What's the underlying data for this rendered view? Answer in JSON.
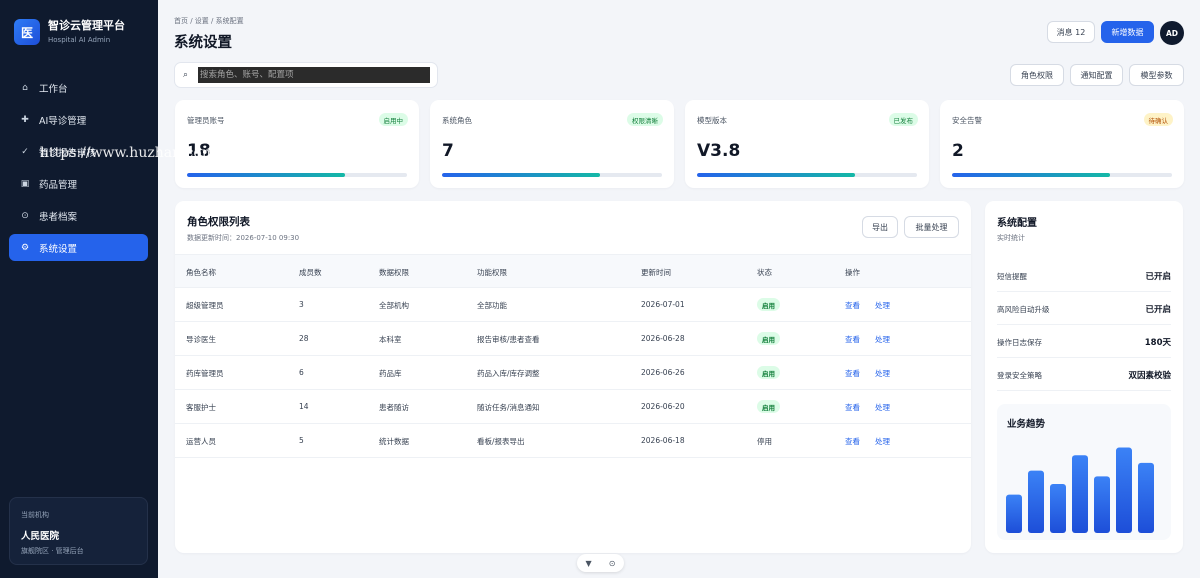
{
  "brand": {
    "logo": "医",
    "title": "智诊云管理平台",
    "subtitle": "Hospital AI Admin"
  },
  "nav": [
    {
      "icon": "home-icon",
      "glyph": "⌂",
      "label": "工作台",
      "active": false
    },
    {
      "icon": "plus-icon",
      "glyph": "✚",
      "label": "AI导诊管理",
      "active": false
    },
    {
      "icon": "check-icon",
      "glyph": "✓",
      "label": "智诊报告审核",
      "active": false
    },
    {
      "icon": "box-icon",
      "glyph": "▣",
      "label": "药品管理",
      "active": false
    },
    {
      "icon": "target-icon",
      "glyph": "⊙",
      "label": "患者档案",
      "active": false
    },
    {
      "icon": "gear-icon",
      "glyph": "⚙",
      "label": "系统设置",
      "active": true
    }
  ],
  "watermark": "https://www.huzhan.com/ishop46882",
  "org": {
    "label": "当前机构",
    "name": "人民医院",
    "sub": "旗舰院区 · 管理后台"
  },
  "header": {
    "breadcrumb": "首页 / 设置 / 系统配置",
    "title": "系统设置",
    "messages_label": "消息 12",
    "add_label": "新增数据",
    "avatar": "AD"
  },
  "search": {
    "placeholder": "搜索角色、账号、配置项"
  },
  "toolbar": {
    "roles": "角色权限",
    "notify": "通知配置",
    "model": "模型参数"
  },
  "stats": [
    {
      "label": "管理员账号",
      "badge": "启用中",
      "badge_type": "green",
      "value": "18",
      "progress": 0.72
    },
    {
      "label": "系统角色",
      "badge": "权限清晰",
      "badge_type": "green",
      "value": "7",
      "progress": 0.72
    },
    {
      "label": "模型版本",
      "badge": "已发布",
      "badge_type": "green",
      "value": "V3.8",
      "progress": 0.72
    },
    {
      "label": "安全告警",
      "badge": "待确认",
      "badge_type": "orange",
      "value": "2",
      "progress": 0.72
    }
  ],
  "table": {
    "title": "角色权限列表",
    "subtitle": "数据更新时间：2026-07-10 09:30",
    "export_label": "导出",
    "batch_label": "批量处理",
    "columns": [
      "角色名称",
      "成员数",
      "数据权限",
      "功能权限",
      "更新时间",
      "状态",
      "操作"
    ],
    "view_label": "查看",
    "handle_label": "处理",
    "rows": [
      {
        "name": "超级管理员",
        "members": "3",
        "data": "全部机构",
        "func": "全部功能",
        "updated": "2026-07-01",
        "status": "启用",
        "on": true
      },
      {
        "name": "导诊医生",
        "members": "28",
        "data": "本科室",
        "func": "报告审核/患者查看",
        "updated": "2026-06-28",
        "status": "启用",
        "on": true
      },
      {
        "name": "药库管理员",
        "members": "6",
        "data": "药品库",
        "func": "药品入库/库存调整",
        "updated": "2026-06-26",
        "status": "启用",
        "on": true
      },
      {
        "name": "客服护士",
        "members": "14",
        "data": "患者随访",
        "func": "随访任务/消息通知",
        "updated": "2026-06-20",
        "status": "启用",
        "on": true
      },
      {
        "name": "运营人员",
        "members": "5",
        "data": "统计数据",
        "func": "看板/报表导出",
        "updated": "2026-06-18",
        "status": "停用",
        "on": false
      }
    ]
  },
  "config": {
    "title": "系统配置",
    "subtitle": "实时统计",
    "items": [
      {
        "key": "短信提醒",
        "value": "已开启"
      },
      {
        "key": "高风险自动升级",
        "value": "已开启"
      },
      {
        "key": "操作日志保存",
        "value": "180天"
      },
      {
        "key": "登录安全策略",
        "value": "双因素校验"
      }
    ],
    "trend_title": "业务趋势"
  },
  "chart_data": {
    "type": "bar",
    "title": "业务趋势",
    "values": [
      40,
      65,
      51,
      81,
      59,
      89,
      73
    ],
    "ylim": [
      0,
      100
    ],
    "color": "#2563eb"
  },
  "float": {
    "down_glyph": "▼",
    "target_glyph": "⊙"
  }
}
